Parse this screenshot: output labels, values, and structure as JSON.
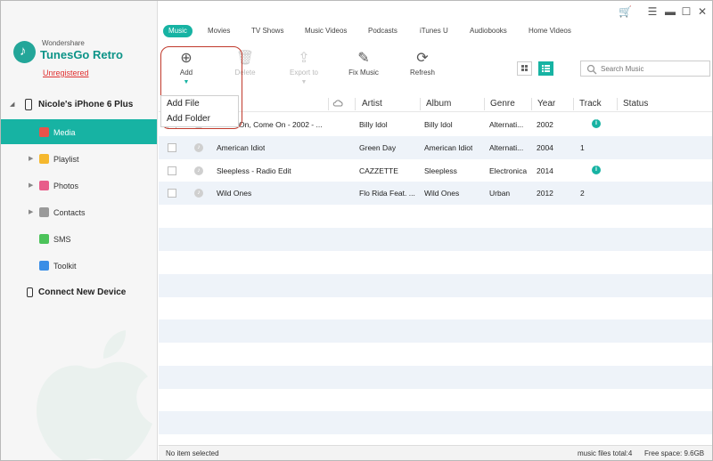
{
  "app": {
    "brand_small": "Wondershare",
    "brand_big": "TunesGo Retro",
    "registration": "Unregistered"
  },
  "sidebar": {
    "device": "Nicole's iPhone 6 Plus",
    "items": [
      {
        "label": "Media",
        "icon": "music-icon",
        "color": "#e8534a",
        "expandable": false,
        "active": true
      },
      {
        "label": "Playlist",
        "icon": "playlist-icon",
        "color": "#f5b82e",
        "expandable": true,
        "active": false
      },
      {
        "label": "Photos",
        "icon": "photos-icon",
        "color": "#e85d8a",
        "expandable": true,
        "active": false
      },
      {
        "label": "Contacts",
        "icon": "contacts-icon",
        "color": "#9a9a9a",
        "expandable": true,
        "active": false
      },
      {
        "label": "SMS",
        "icon": "sms-icon",
        "color": "#4cc35a",
        "expandable": false,
        "active": false
      },
      {
        "label": "Toolkit",
        "icon": "toolkit-icon",
        "color": "#3a8ee6",
        "expandable": false,
        "active": false
      }
    ],
    "connect": "Connect New Device"
  },
  "tabs": [
    "Music",
    "Movies",
    "TV Shows",
    "Music Videos",
    "Podcasts",
    "iTunes U",
    "Audiobooks",
    "Home Videos"
  ],
  "toolbar": {
    "add": "Add",
    "delete": "Delete",
    "export": "Export to",
    "fix": "Fix Music",
    "refresh": "Refresh"
  },
  "add_menu": [
    "Add File",
    "Add Folder"
  ],
  "search": {
    "placeholder": "Search Music"
  },
  "table": {
    "columns": [
      "Artist",
      "Album",
      "Genre",
      "Year",
      "Track",
      "Status"
    ],
    "rows": [
      {
        "title": "Come On, Come On - 2002 - ...",
        "artist": "Billy Idol",
        "album": "Billy Idol",
        "genre": "Alternati...",
        "year": "2002",
        "track": "",
        "info": true
      },
      {
        "title": "American Idiot",
        "artist": "Green Day",
        "album": "American Idiot",
        "genre": "Alternati...",
        "year": "2004",
        "track": "1",
        "info": false
      },
      {
        "title": "Sleepless - Radio Edit",
        "artist": "CAZZETTE",
        "album": "Sleepless",
        "genre": "Electronica",
        "year": "2014",
        "track": "",
        "info": true
      },
      {
        "title": "Wild Ones",
        "artist": "Flo Rida Feat. ...",
        "album": "Wild Ones",
        "genre": "Urban",
        "year": "2012",
        "track": "2",
        "info": false
      }
    ]
  },
  "status": {
    "left": "No item selected",
    "total": "music files total:4",
    "free": "Free space: 9.6GB"
  },
  "colors": {
    "accent": "#17b3a3",
    "highlight_border": "#c0392b",
    "unregistered": "#e03131"
  }
}
